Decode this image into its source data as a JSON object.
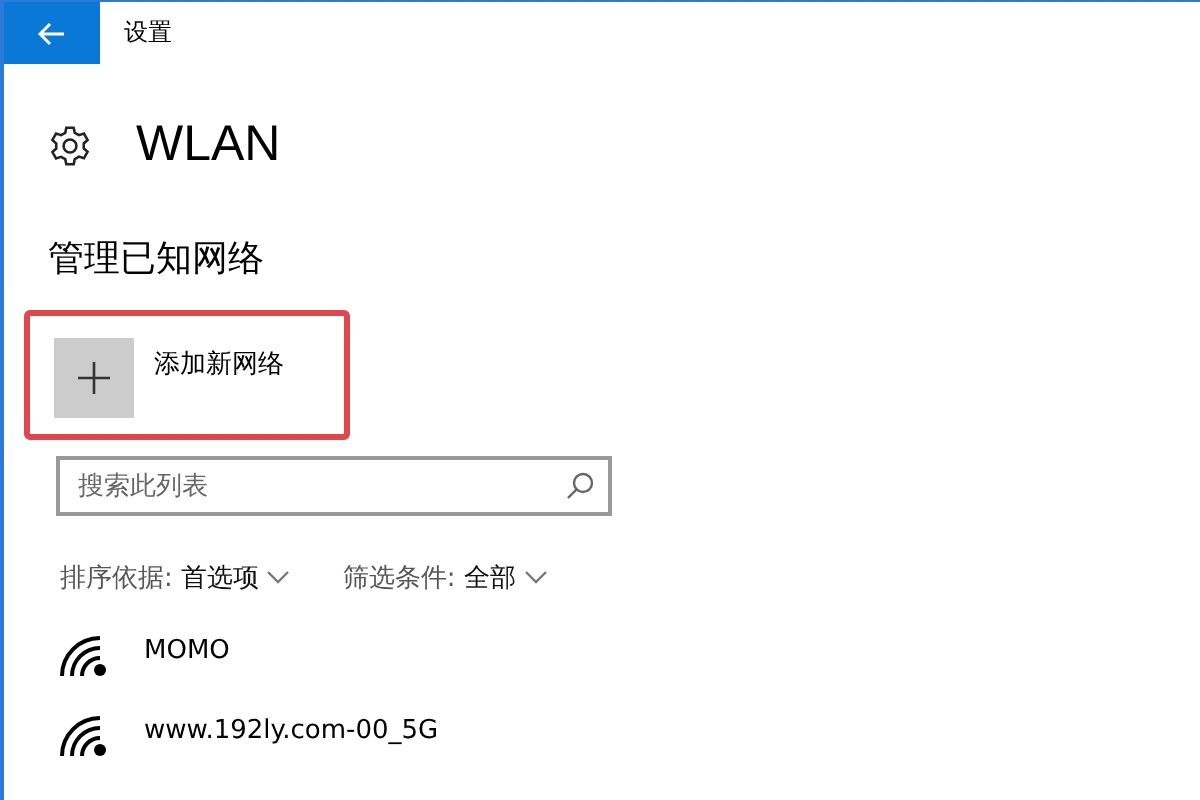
{
  "window": {
    "title": "设置"
  },
  "page": {
    "title": "WLAN"
  },
  "section": {
    "title": "管理已知网络"
  },
  "add_network": {
    "label": "添加新网络",
    "highlighted": true
  },
  "search": {
    "placeholder": "搜索此列表"
  },
  "sort": {
    "label": "排序依据:",
    "value": "首选项"
  },
  "filter": {
    "label": "筛选条件:",
    "value": "全部"
  },
  "networks": [
    {
      "name": "MOMO"
    },
    {
      "name": "www.192ly.com-00_5G"
    }
  ]
}
